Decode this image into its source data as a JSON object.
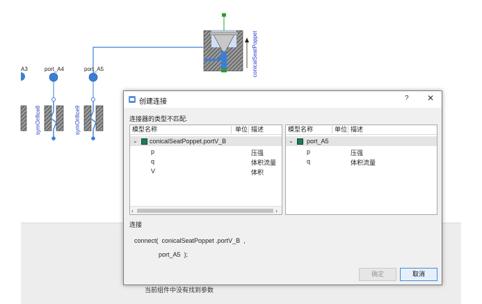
{
  "canvas": {
    "ports": [
      {
        "label": "A3"
      },
      {
        "label": "port_A4"
      },
      {
        "label": "port_A5"
      }
    ],
    "components": [
      {
        "label": "symOrifice8"
      },
      {
        "label": "symOrifice9"
      },
      {
        "label": "conicalSeatPoppet"
      }
    ],
    "status_text": "当前组件中没有找到参数"
  },
  "dialog": {
    "title": "创建连接",
    "help_label": "?",
    "close_label": "✕",
    "message": "连接器的类型不匹配.",
    "left_panel": {
      "headers": [
        "模型名称",
        "单位",
        "描述"
      ],
      "root": "conicalSeatPoppet.portV_B",
      "rows": [
        {
          "name": "p",
          "unit": "",
          "desc": "压强"
        },
        {
          "name": "q",
          "unit": "",
          "desc": "体积流量"
        },
        {
          "name": "V",
          "unit": "",
          "desc": "体积"
        }
      ]
    },
    "right_panel": {
      "headers": [
        "模型名称",
        "单位",
        "描述"
      ],
      "root": "port_A5",
      "rows": [
        {
          "name": "p",
          "unit": "",
          "desc": "压强"
        },
        {
          "name": "q",
          "unit": "",
          "desc": "体积流量"
        }
      ]
    },
    "connection_label": "连接",
    "code_line1": "connect(  conicalSeatPoppet .portV_B  ,",
    "code_line2": "port_A5  );",
    "ok_label": "确定",
    "cancel_label": "取消"
  },
  "colors": {
    "wire": "#3a7fd5",
    "port_fill": "#3a7fd5",
    "component_hatch": "#555555",
    "label_blue": "#2b3cc8",
    "poppet_green": "#2aa02a"
  }
}
